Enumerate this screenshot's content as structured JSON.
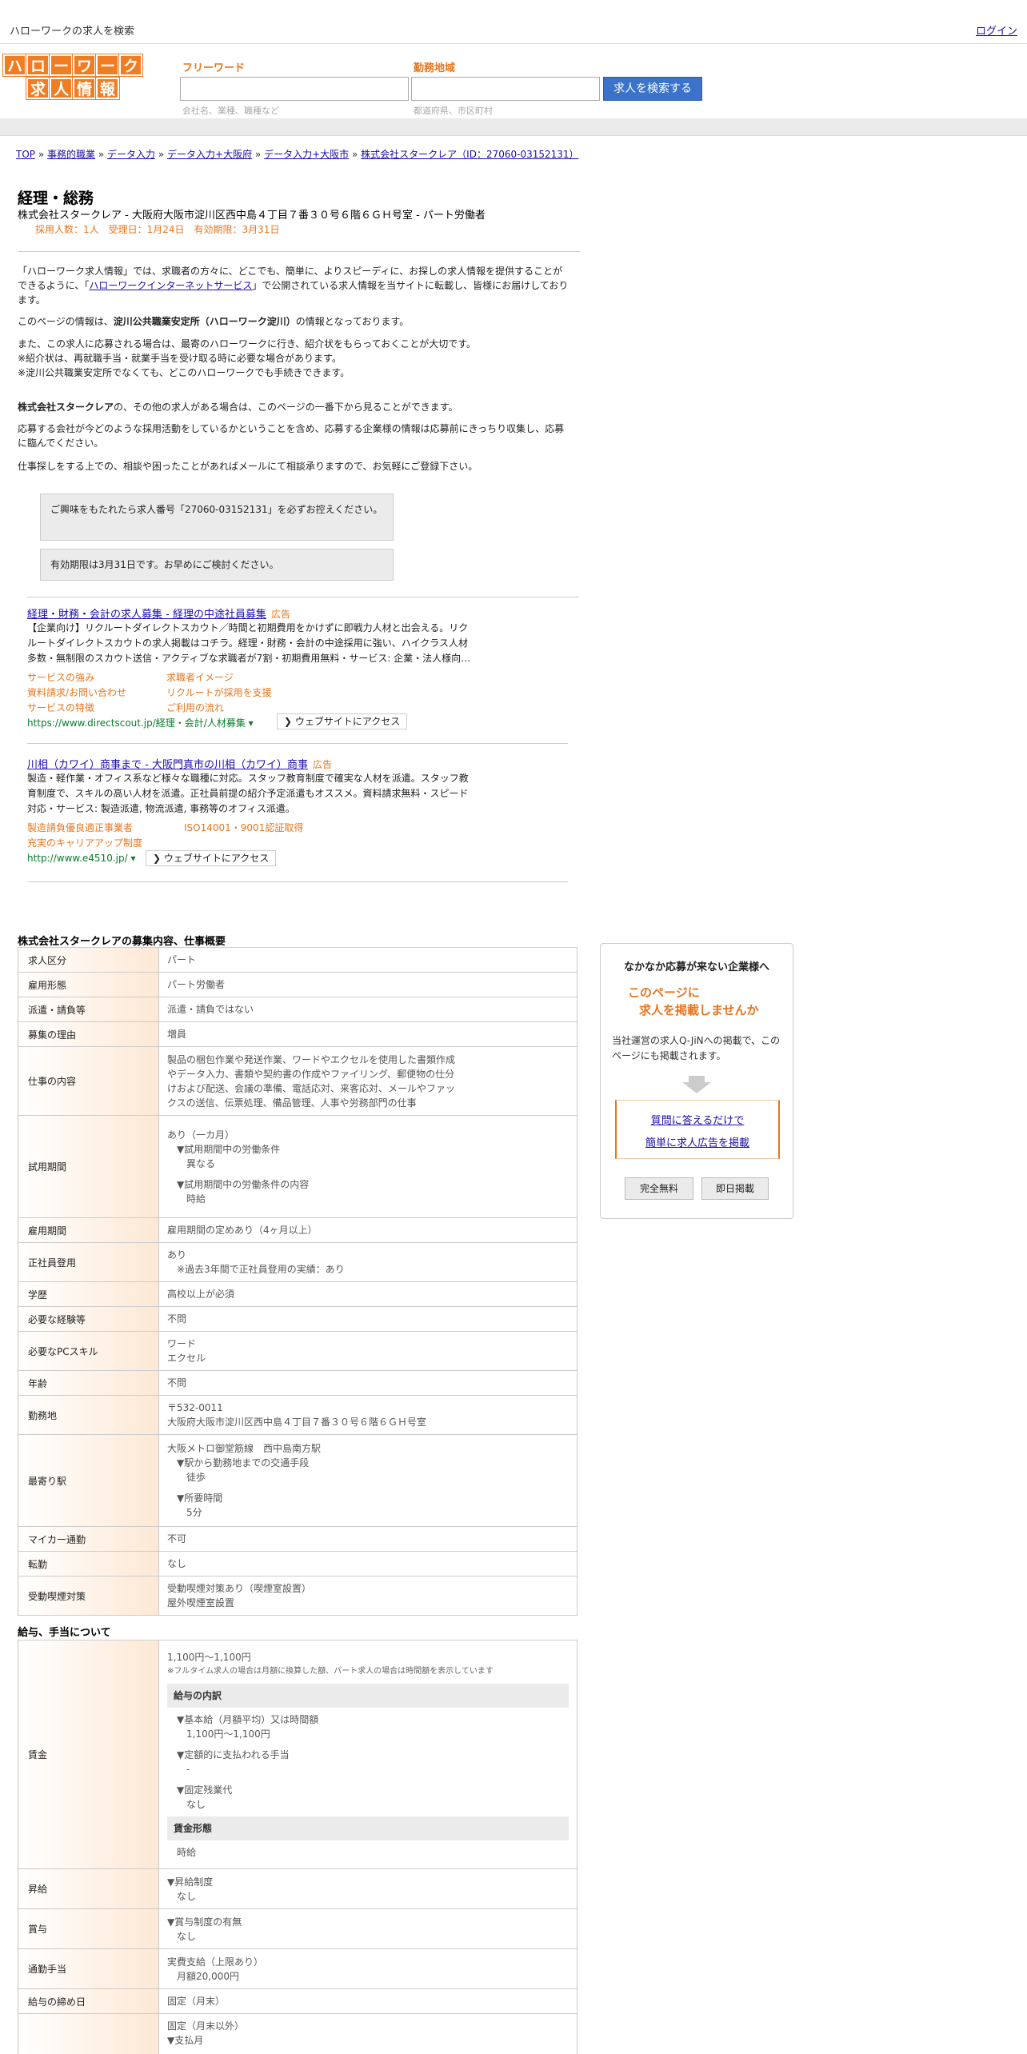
{
  "header": {
    "tagline": "ハローワークの求人を検索",
    "login": "ログイン",
    "logo_top": [
      "ハ",
      "ロ",
      "ー",
      "ワ",
      "ー",
      "ク"
    ],
    "logo_bottom": [
      "求",
      "人",
      "情",
      "報"
    ],
    "freeword_label": "フリーワード",
    "area_label": "勤務地域",
    "freeword_hint": "会社名、業種、職種など",
    "area_hint": "都道府県、市区町村",
    "freeword_value": "",
    "area_value": "",
    "search_button": "求人を検索する"
  },
  "breadcrumb": {
    "items": [
      "TOP",
      "事務的職業",
      "データ入力",
      "データ入力+大阪府",
      "データ入力+大阪市",
      "株式会社スタークレア（ID：27060-03152131）"
    ],
    "separator": "»"
  },
  "job": {
    "title": "経理・総務",
    "subtitle": "株式会社スタークレア - 大阪府大阪市淀川区西中島４丁目７番３０号６階６ＧＨ号室 - パート労働者",
    "meta": "採用人数：1人　受理日：1月24日　有効期限：3月31日"
  },
  "intro": {
    "p1_a": "「ハローワーク求人情報」では、求職者の方々に、どこでも、簡単に、よりスピーディに、お探しの求人情報を提供することができるように、「",
    "p1_link": "ハローワークインターネットサービス",
    "p1_b": "」で公開されている求人情報を当サイトに転載し、皆様にお届けしております。",
    "p2_a": "このページの情報は、",
    "p2_bold": "淀川公共職業安定所（ハローワーク淀川）",
    "p2_b": "の情報となっております。",
    "p3_l1": "また、この求人に応募される場合は、最寄のハローワークに行き、紹介状をもらっておくことが大切です。",
    "p3_l2": "※紹介状は、再就職手当・就業手当を受け取る時に必要な場合があります。",
    "p3_l3": "※淀川公共職業安定所でなくても、どこのハローワークでも手続きできます。",
    "p4_bold": "株式会社スタークレア",
    "p4_rest": "の、その他の求人がある場合は、このページの一番下から見ることができます。",
    "p5": "応募する会社が今どのような採用活動をしているかということを含め、応募する企業様の情報は応募前にきっちり収集し、応募に臨んでください。",
    "p6": "仕事探しをする上での、相談や困ったことがあればメールにて相談承りますので、お気軽にご登録下さい。",
    "box1": "ご興味をもたれたら求人番号「27060-03152131」を必ずお控えください。",
    "box2": "有効期限は3月31日です。お早めにご検討ください。"
  },
  "ads": [
    {
      "title": "経理・財務・会計の求人募集 - 経理の中途社員募集",
      "badge": "広告",
      "desc_l1": "【企業向け】リクルートダイレクトスカウト／時間と初期費用をかけずに即戦力人材と出会える。リク",
      "desc_l2": "ルートダイレクトスカウトの求人掲載はコチラ。経理・財務・会計の中途採用に強い、ハイクラス人材",
      "desc_l3": "多数・無制限のスカウト送信・アクティブな求職者が7割・初期費用無料・サービス: 企業・法人様向…",
      "links": [
        "サービスの強み",
        "求職者イメージ",
        "資料請求/お問い合わせ",
        "リクルートが採用を支援",
        "サービスの特徴",
        "ご利用の流れ"
      ],
      "url": "https://www.directscout.jp/経理・会計/人材募集",
      "url_caret": "▾",
      "button": "❯ ウェブサイトにアクセス"
    },
    {
      "title": "川相（カワイ）商事まで - 大阪門真市の川相（カワイ）商事",
      "badge": "広告",
      "desc_l1": "製造・軽作業・オフィス系など様々な職種に対応。スタッフ教育制度で確実な人材を派遣。スタッフ教",
      "desc_l2": "育制度で、スキルの高い人材を派遣。正社員前提の紹介予定派遣もオススメ。資料請求無料・スピード",
      "desc_l3": "対応・サービス: 製造派遣, 物流派遣, 事務等のオフィス派遣。",
      "links": [
        "製造請負優良適正事業者",
        "ISO14001・9001認証取得",
        "充実のキャリアアップ制度"
      ],
      "url": "http://www.e4510.jp/",
      "url_caret": "▾",
      "button": "❯ ウェブサイトにアクセス"
    }
  ],
  "outline": {
    "title": "株式会社スタークレアの募集内容、仕事概要",
    "rows": [
      {
        "label": "求人区分",
        "lines": [
          "パート"
        ]
      },
      {
        "label": "雇用形態",
        "lines": [
          "パート労働者"
        ]
      },
      {
        "label": "派遣・請負等",
        "lines": [
          "派遣・請負ではない"
        ]
      },
      {
        "label": "募集の理由",
        "lines": [
          "増員"
        ]
      },
      {
        "label": "仕事の内容",
        "lines": [
          "製品の梱包作業や発送作業、ワードやエクセルを使用した書類作成",
          "やデータ入力、書類や契約書の作成やファイリング、郵便物の仕分",
          "けおよび配送、会議の準備、電話応対、来客応対、メールやファッ",
          "クスの送信、伝票処理、備品管理、人事や労務部門の仕事"
        ]
      },
      {
        "label": "試用期間",
        "lines": [
          "あり（一カ月）",
          "▼試用期間中の労働条件",
          "異なる",
          "",
          "▼試用期間中の労働条件の内容",
          "時給"
        ]
      },
      {
        "label": "雇用期間",
        "lines": [
          "雇用期間の定めあり（4ヶ月以上）"
        ]
      },
      {
        "label": "正社員登用",
        "lines": [
          "あり",
          "※過去3年間で正社員登用の実績：あり"
        ]
      },
      {
        "label": "学歴",
        "lines": [
          "高校以上が必須"
        ]
      },
      {
        "label": "必要な経験等",
        "lines": [
          "不問"
        ]
      },
      {
        "label": "必要なPCスキル",
        "lines": [
          "ワード",
          "エクセル"
        ]
      },
      {
        "label": "年齢",
        "lines": [
          "不問"
        ]
      },
      {
        "label": "勤務地",
        "lines": [
          "〒532-0011",
          "大阪府大阪市淀川区西中島４丁目７番３０号６階６ＧＨ号室"
        ]
      },
      {
        "label": "最寄り駅",
        "lines": [
          "大阪メトロ御堂筋線　西中島南方駅",
          "▼駅から勤務地までの交通手段",
          "徒歩",
          "",
          "▼所要時間",
          "5分"
        ]
      },
      {
        "label": "マイカー通勤",
        "lines": [
          "不可"
        ]
      },
      {
        "label": "転勤",
        "lines": [
          "なし"
        ]
      },
      {
        "label": "受動喫煙対策",
        "lines": [
          "受動喫煙対策あり（喫煙室設置）",
          "屋外喫煙室設置"
        ]
      }
    ]
  },
  "salary": {
    "title": "給与、手当について",
    "wage_label": "賃金",
    "wage_range": "1,100円〜1,100円",
    "wage_note": "※フルタイム求人の場合は月額に換算した額、パート求人の場合は時間額を表示しています",
    "breakdown_header": "給与の内訳",
    "basic_label": "▼基本給（月額平均）又は時間額",
    "basic_value": "1,100円〜1,100円",
    "fixed_label": "▼定額的に支払われる手当",
    "fixed_value": "-",
    "overtime_label": "▼固定残業代",
    "overtime_value": "なし",
    "form_header": "賃金形態",
    "form_value": "時給",
    "raise_label": "昇給",
    "raise_l1": "▼昇給制度",
    "raise_l2": "なし",
    "bonus_label": "賞与",
    "bonus_l1": "▼賞与制度の有無",
    "bonus_l2": "なし",
    "commute_label": "通勤手当",
    "commute_l1": "実費支給（上限あり）",
    "commute_l2": "月額20,000円",
    "closing_label": "給与の締め日",
    "closing_value": "固定（月末）",
    "payday_l1": "固定（月末以外）",
    "payday_l2": "▼支払月"
  },
  "sidebar": {
    "title": "なかなか応募が来ない企業様へ",
    "catch1": "このページに",
    "catch2": "求人を掲載しませんか",
    "desc": "当社運営の求人Q-JiNへの掲載で、このページにも掲載されます。",
    "link1": "質問に答えるだけで",
    "link2": "簡単に求人広告を掲載",
    "btn1": "完全無料",
    "btn2": "即日掲載"
  },
  "colors": {
    "accent": "#e8761e",
    "link": "#1a0dab",
    "search_button": "#3a73c9",
    "url_green": "#0a7d2c"
  }
}
